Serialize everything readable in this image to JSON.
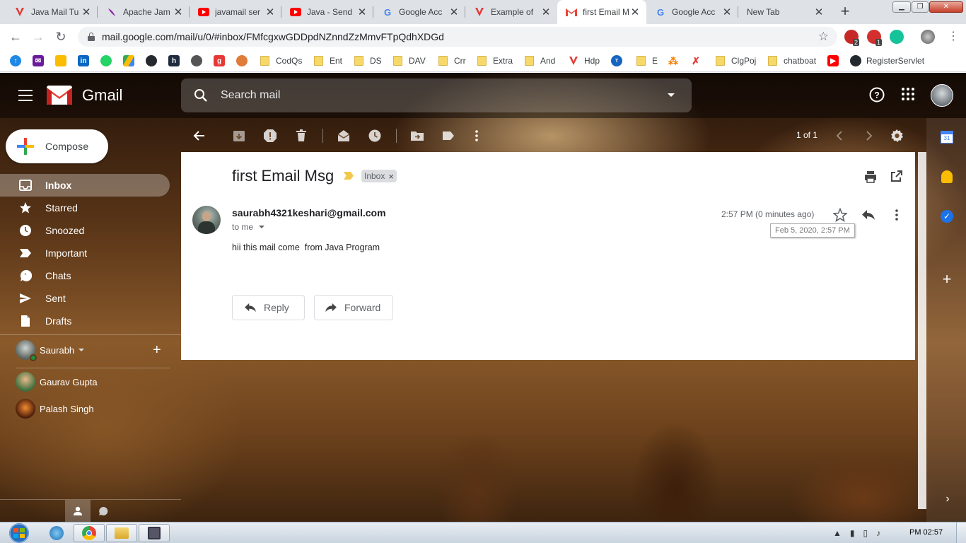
{
  "browser": {
    "tabs": [
      {
        "title": "Java Mail Tu",
        "favicon": "red-v-icon"
      },
      {
        "title": "Apache Jam",
        "favicon": "feather-icon"
      },
      {
        "title": "javamail ser",
        "favicon": "youtube-icon"
      },
      {
        "title": "Java - Send",
        "favicon": "youtube-icon"
      },
      {
        "title": "Google Acc",
        "favicon": "google-icon"
      },
      {
        "title": "Example of",
        "favicon": "red-v-icon"
      },
      {
        "title": "first Email M",
        "favicon": "gmail-icon",
        "active": true
      },
      {
        "title": "Google Acc",
        "favicon": "google-icon"
      },
      {
        "title": "New Tab",
        "favicon": ""
      }
    ],
    "url": "mail.google.com/mail/u/0/#inbox/FMfcgxwGDDpdNZnndZzMmvFTpQdhXDGd",
    "extension_badges": [
      "2",
      "1"
    ],
    "bookmarks": [
      "CodQs",
      "Ent",
      "DS",
      "DAV",
      "Crr",
      "Extra",
      "And",
      "Hdp",
      "E",
      "ClgPoj",
      "chatboat",
      "RegisterServlet"
    ]
  },
  "gmail": {
    "app_name": "Gmail",
    "search_placeholder": "Search mail",
    "compose_label": "Compose",
    "nav": [
      {
        "label": "Inbox",
        "icon": "inbox-icon",
        "active": true
      },
      {
        "label": "Starred",
        "icon": "star-icon"
      },
      {
        "label": "Snoozed",
        "icon": "clock-icon"
      },
      {
        "label": "Important",
        "icon": "important-icon"
      },
      {
        "label": "Chats",
        "icon": "chat-icon"
      },
      {
        "label": "Sent",
        "icon": "send-icon"
      },
      {
        "label": "Drafts",
        "icon": "draft-icon"
      }
    ],
    "hangouts": {
      "me": "Saurabh",
      "contacts": [
        "Gaurav Gupta",
        "Palash Singh"
      ]
    },
    "pagination": "1 of 1",
    "message": {
      "subject": "first Email Msg",
      "label": "Inbox",
      "sender": "saurabh4321keshari@gmail.com",
      "to": "to me",
      "time": "2:57 PM (0 minutes ago)",
      "tooltip": "Feb 5, 2020, 2:57 PM",
      "body": "hii this mail come  from Java Program",
      "reply_label": "Reply",
      "forward_label": "Forward"
    }
  },
  "taskbar": {
    "clock": "PM 02:57"
  },
  "colors": {
    "gmail_red": "#ea4335",
    "google_blue": "#4285f4",
    "google_green": "#34a853",
    "google_yellow": "#fbbc04"
  }
}
